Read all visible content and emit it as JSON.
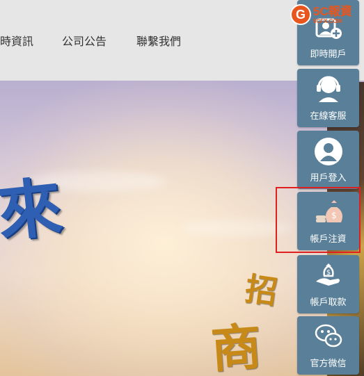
{
  "nav": {
    "items": [
      {
        "label": "時資訊"
      },
      {
        "label": "公司公告"
      },
      {
        "label": "聯繫我們"
      }
    ]
  },
  "hero": {
    "big_char": "來",
    "calli_1": "招",
    "calli_2": "商"
  },
  "sidebar": {
    "items": [
      {
        "label": "即時開戶",
        "icon": "add-user-icon"
      },
      {
        "label": "在線客服",
        "icon": "headset-icon"
      },
      {
        "label": "用戶登入",
        "icon": "user-icon"
      },
      {
        "label": "帳戶注資",
        "icon": "money-bag-icon"
      },
      {
        "label": "帳戶取款",
        "icon": "withdraw-hand-icon"
      },
      {
        "label": "官方微信",
        "icon": "wechat-icon"
      }
    ]
  },
  "logo": {
    "mark": "G",
    "text": "5C報資",
    "sub": "5CFX.COM"
  },
  "colors": {
    "sidebar": "#5a7f98",
    "highlight": "#e02020",
    "logo": "#e8561e"
  }
}
